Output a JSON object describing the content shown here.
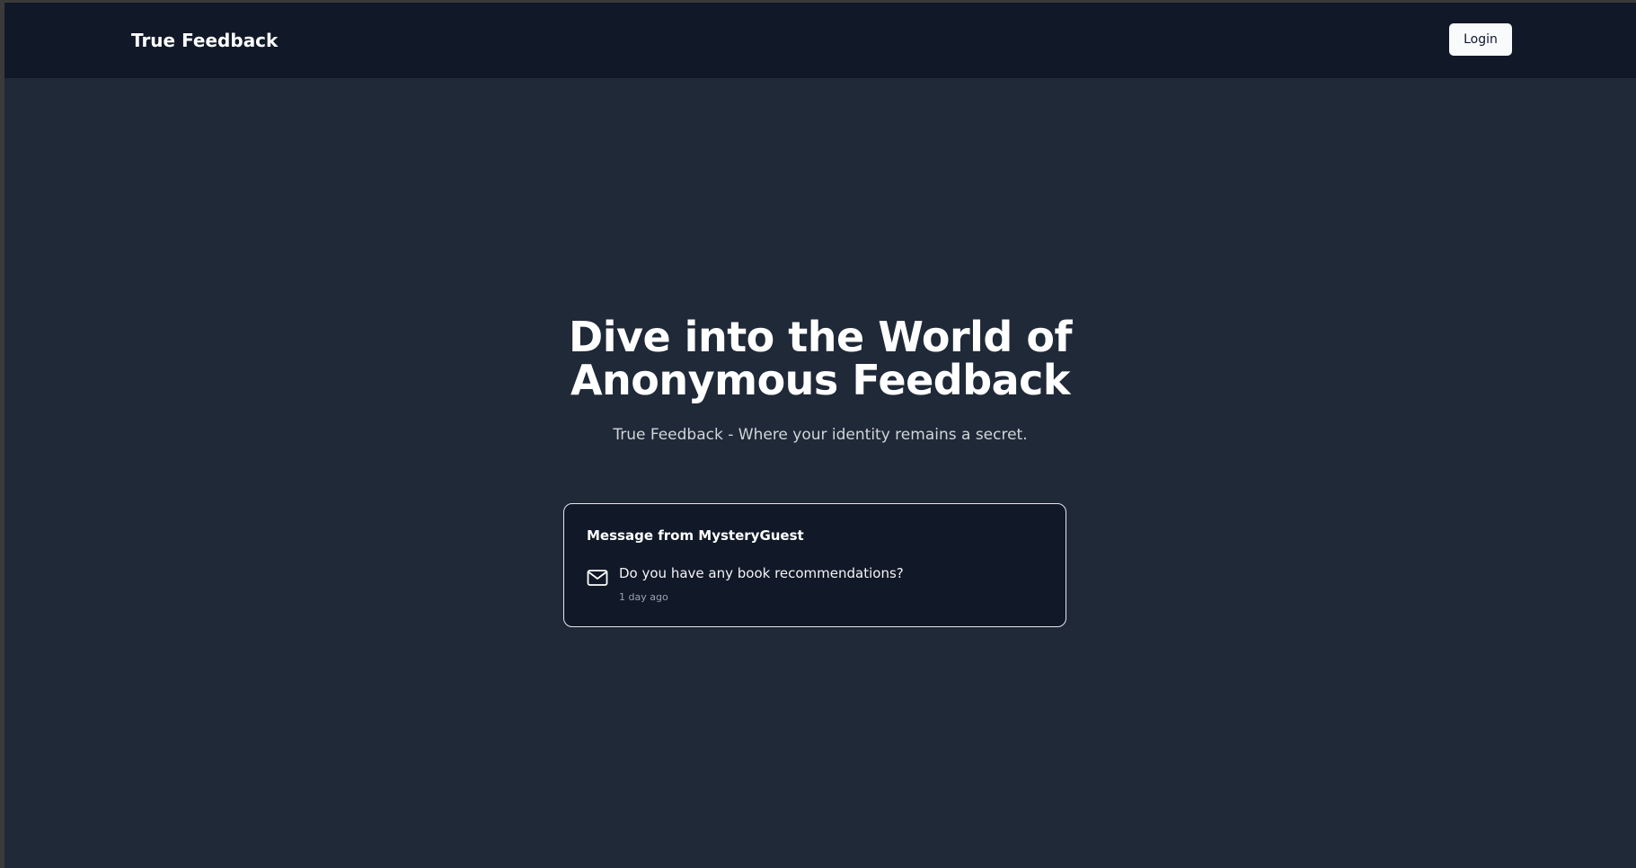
{
  "navbar": {
    "brand": "True Feedback",
    "login_label": "Login"
  },
  "hero": {
    "title_line1": "Dive into the World of",
    "title_line2": "Anonymous Feedback",
    "subtitle": "True Feedback - Where your identity remains a secret."
  },
  "message_card": {
    "title": "Message from MysteryGuest",
    "icon": "mail-icon",
    "content": "Do you have any book recommendations?",
    "time": "1 day ago"
  },
  "colors": {
    "page_background": "#1f2937",
    "navbar_background": "#111827",
    "card_background": "#111827",
    "card_border": "#e5e7eb",
    "button_background": "#f8fafc",
    "text_primary": "#ffffff",
    "text_muted": "#9ca3af"
  }
}
